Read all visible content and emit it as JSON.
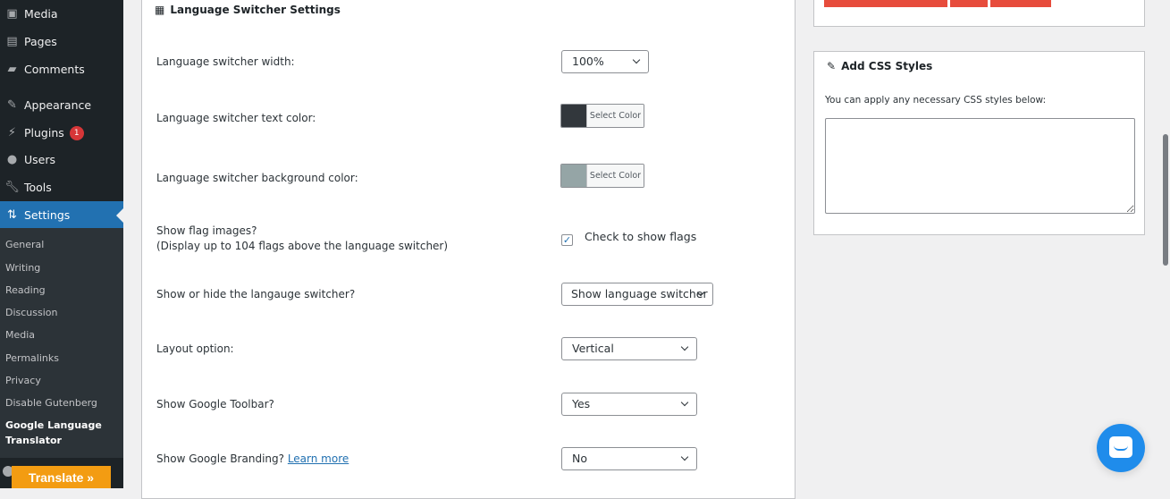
{
  "sidebar": {
    "items": [
      {
        "label": "Media",
        "icon": "media-icon"
      },
      {
        "label": "Pages",
        "icon": "pages-icon"
      },
      {
        "label": "Comments",
        "icon": "comments-icon"
      },
      {
        "label": "Appearance",
        "icon": "appearance-icon"
      },
      {
        "label": "Plugins",
        "icon": "plugins-icon",
        "badge": "1"
      },
      {
        "label": "Users",
        "icon": "users-icon"
      },
      {
        "label": "Tools",
        "icon": "tools-icon"
      },
      {
        "label": "Settings",
        "icon": "settings-icon",
        "active": true
      }
    ],
    "submenu": [
      "General",
      "Writing",
      "Reading",
      "Discussion",
      "Media",
      "Permalinks",
      "Privacy",
      "Disable Gutenberg",
      "Google Language Translator"
    ],
    "translate": "Translate »"
  },
  "main": {
    "title": "Language Switcher Settings",
    "width_label": "Language switcher width:",
    "width_value": "100%",
    "text_color_label": "Language switcher text color:",
    "text_color": "#32373c",
    "bg_color_label": "Language switcher background color:",
    "bg_color": "#95a5a6",
    "select_color": "Select Color",
    "flags_label": "Show flag images?",
    "flags_sub": "(Display up to 104 flags above the language switcher)",
    "flags_check": "Check to show flags",
    "flags_checked": true,
    "show_hide_label": "Show or hide the langauge switcher?",
    "show_hide_value": "Show language switcher",
    "layout_label": "Layout option:",
    "layout_value": "Vertical",
    "toolbar_label": "Show Google Toolbar?",
    "toolbar_value": "Yes",
    "branding_label": "Show Google Branding?",
    "branding_link": "Learn more",
    "branding_value": "No"
  },
  "css_panel": {
    "title": "Add CSS Styles",
    "desc": "You can apply any necessary CSS styles below:",
    "value": ""
  },
  "colors": {
    "accent": "#2271b1",
    "red_buttons": "#e74c3c",
    "translate": "#f39c12",
    "chat": "#1f8ceb"
  }
}
